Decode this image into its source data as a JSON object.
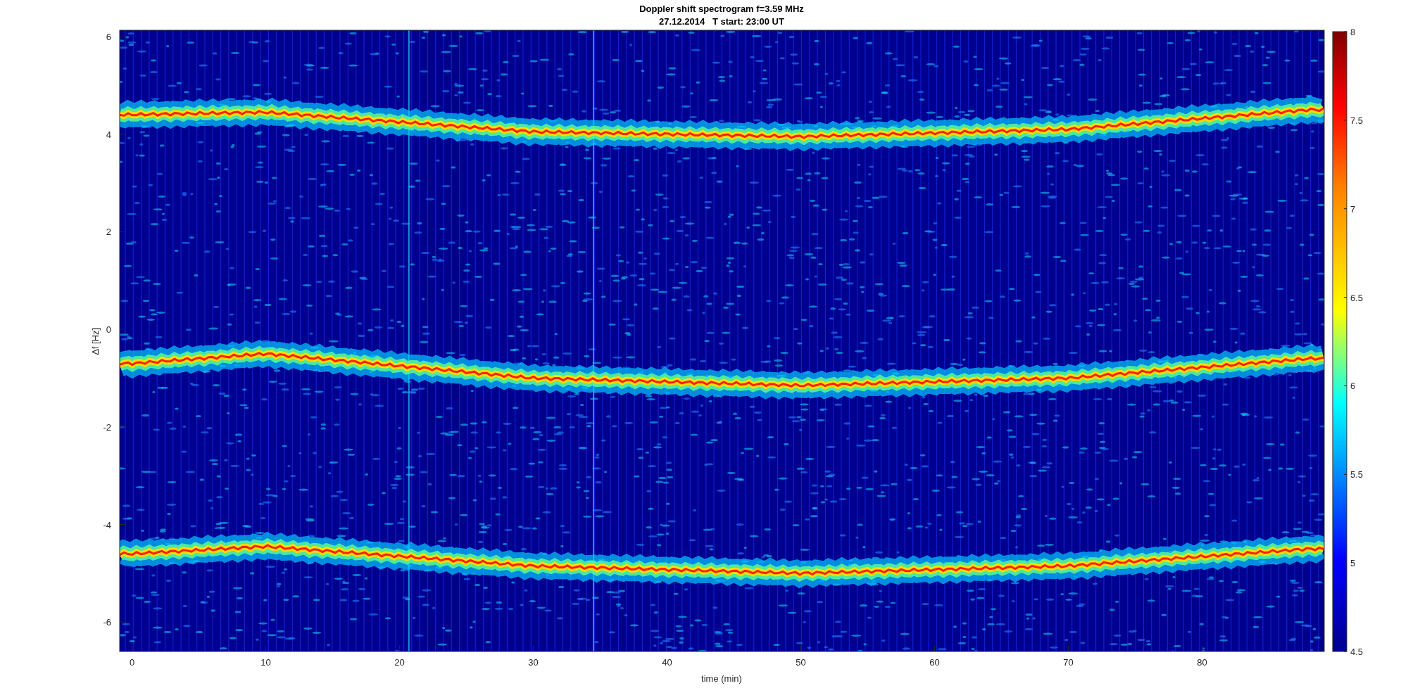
{
  "figure": {
    "title": "Doppler shift spectrogram f=3.59 MHz",
    "subtitle": "27.12.2014   T start: 23:00 UT",
    "xlabel": "time (min)",
    "ylabel": "∆f [Hz]",
    "xticks": [
      "0",
      "10",
      "20",
      "30",
      "40",
      "50",
      "60",
      "70",
      "80"
    ],
    "yticks": [
      "6",
      "4",
      "2",
      "0",
      "-2",
      "-4",
      "-6"
    ],
    "colorbar_ticks": [
      "8",
      "7.5",
      "7",
      "6.5",
      "6",
      "5.5",
      "5",
      "4.5"
    ]
  }
}
